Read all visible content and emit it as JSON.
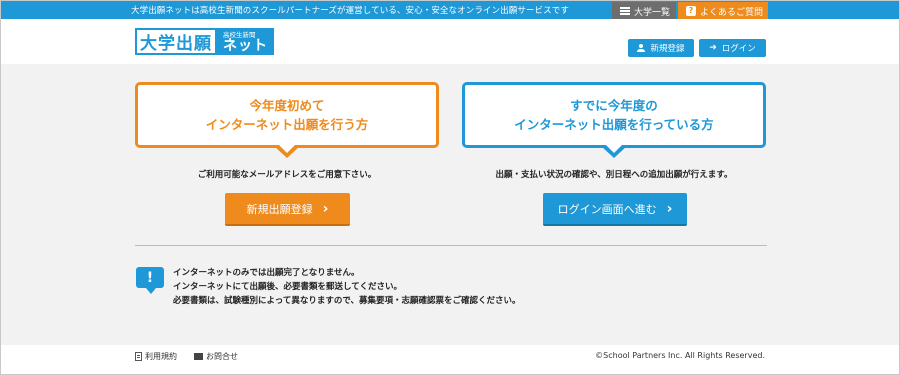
{
  "topbar": {
    "text": "大学出願ネットは高校生新聞のスクールパートナーズが運営している、安心・安全なオンライン出願サービスです",
    "univ_list_label": "大学一覧",
    "faq_label": "よくあるご質問",
    "faq_badge": "?"
  },
  "header": {
    "logo_main": "大学出願",
    "logo_sub": "高校生新聞",
    "logo_net": "ネット",
    "register_label": "新規登録",
    "login_label": "ログイン"
  },
  "main": {
    "new_bubble": {
      "line1": "今年度初めて",
      "line2": "インターネット出願を行う方"
    },
    "existing_bubble": {
      "line1": "すでに今年度の",
      "line2": "インターネット出願を行っている方"
    },
    "new_note": "ご利用可能なメールアドレスをご用意下さい。",
    "existing_note": "出願・支払い状況の確認や、別日程への追加出願が行えます。",
    "new_button_label": "新規出願登録",
    "login_button_label": "ログイン画面へ進む",
    "info": {
      "icon": "!",
      "line1": "インターネットのみでは出願完了となりません。",
      "line2": "インターネットにて出願後、必要書類を郵送してください。",
      "line3": "必要書類は、試験種別によって異なりますので、募集要項・志願確認票をご確認ください。"
    }
  },
  "footer": {
    "terms_label": "利用規約",
    "contact_label": "お問合せ",
    "copyright": "©School Partners Inc. All Rights Reserved."
  },
  "colors": {
    "primary_blue": "#1e98d7",
    "accent_orange": "#ef8a1c",
    "main_bg": "#f2f2f2"
  },
  "icons": {
    "univ_list": "list-icon",
    "faq": "question-icon",
    "register": "user-icon",
    "login": "sign-in-icon",
    "button_arrow": "chevron-right-icon",
    "info": "exclamation-icon",
    "terms": "document-icon",
    "contact": "mail-icon"
  }
}
